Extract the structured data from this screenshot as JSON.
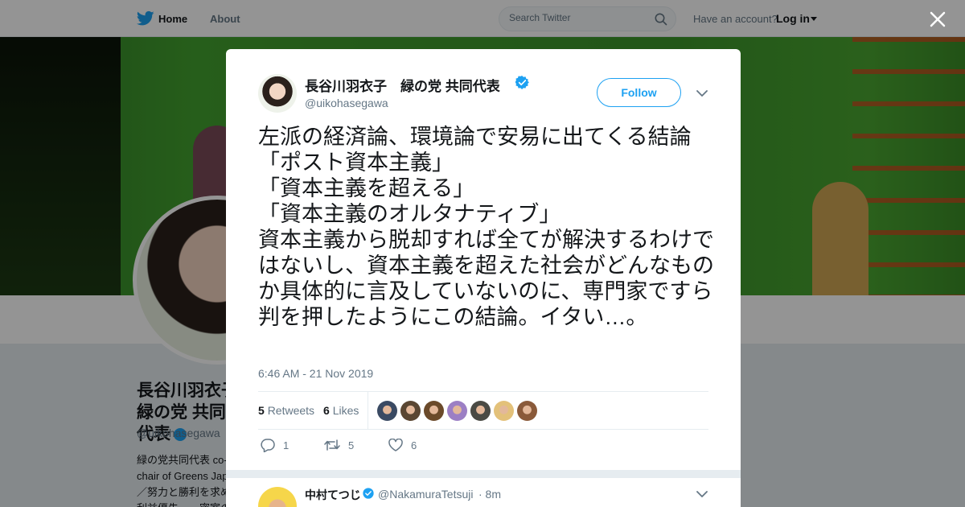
{
  "nav": {
    "home_label": "Home",
    "about_label": "About",
    "search_placeholder": "Search Twitter",
    "have_account": "Have an account?",
    "login_label": "Log in"
  },
  "background_profile": {
    "name": "長谷川羽衣子　緑の党 共同代表",
    "handle": "@uikohasegawa",
    "bio": "緑の党共同代表 co-chair of Greens Japan／努力と勝利を求め、利益優先……密室の権力者……選会：★共著『原"
  },
  "tweet": {
    "author_name": "長谷川羽衣子　緑の党 共同代表",
    "author_handle": "@uikohasegawa",
    "follow_label": "Follow",
    "text": "左派の経済論、環境論で安易に出てくる結論\n「ポスト資本主義」\n「資本主義を超える」\n「資本主義のオルタナティブ」\n資本主義から脱却すれば全てが解決するわけではないし、資本主義を超えた社会がどんなものか具体的に言及していないのに、専門家ですら判を押したようにこの結論。イタい…。",
    "timestamp": "6:46 AM - 21 Nov 2019",
    "retweets_count": "5",
    "retweets_label": "Retweets",
    "likes_count": "6",
    "likes_label": "Likes",
    "actions": {
      "reply_count": "1",
      "retweet_count": "5",
      "like_count": "6"
    },
    "liker_avatar_colors": [
      "#3a4a63",
      "#5a4632",
      "#6b4a2a",
      "#9c7fc4",
      "#4a4a44",
      "#e3c17a",
      "#8a5a3a"
    ]
  },
  "reply": {
    "author_name": "中村てつじ",
    "author_handle": "@NakamuraTetsuji",
    "time": "· 8m"
  },
  "colors": {
    "accent": "#1da1f2",
    "text": "#14171a",
    "muted": "#657786",
    "border": "#e6ecf0"
  },
  "icons": [
    "twitter-bird-icon",
    "home-icon",
    "search-icon",
    "close-icon",
    "verified-icon",
    "chevron-down-icon",
    "reply-icon",
    "retweet-icon",
    "like-icon"
  ]
}
